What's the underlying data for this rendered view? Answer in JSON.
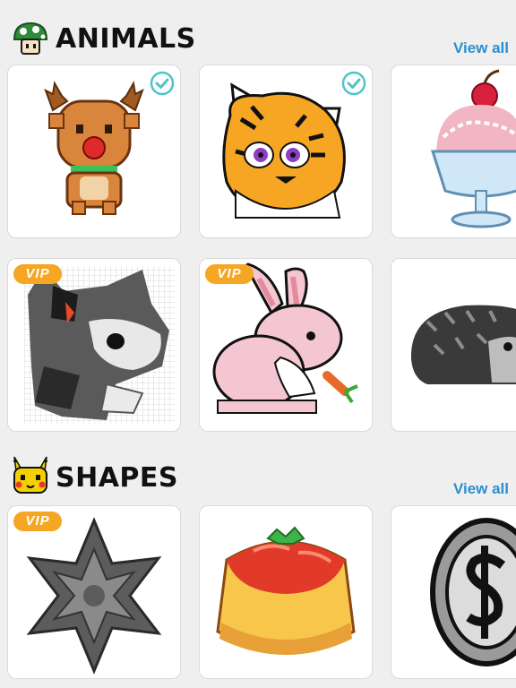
{
  "sections": {
    "animals": {
      "title": "ANIMALS",
      "icon": "mushroom-icon",
      "view_all": "View all",
      "cards": [
        {
          "name": "reindeer",
          "completed": true
        },
        {
          "name": "tiger",
          "completed": true
        },
        {
          "name": "ice-cream-sundae",
          "completed": false
        },
        {
          "name": "gray-cat",
          "badge": "VIP"
        },
        {
          "name": "pink-bunny",
          "badge": "VIP"
        },
        {
          "name": "hedgehog"
        }
      ]
    },
    "shapes": {
      "title": "SHAPES",
      "icon": "pikachu-icon",
      "view_all": "View all",
      "cards": [
        {
          "name": "gray-star",
          "badge": "VIP"
        },
        {
          "name": "pudding"
        },
        {
          "name": "dollar-coin"
        }
      ]
    }
  },
  "colors": {
    "accent": "#2a8fd0",
    "vip": "#f5a623",
    "check": "#4fc3c9",
    "background": "#efefef"
  }
}
